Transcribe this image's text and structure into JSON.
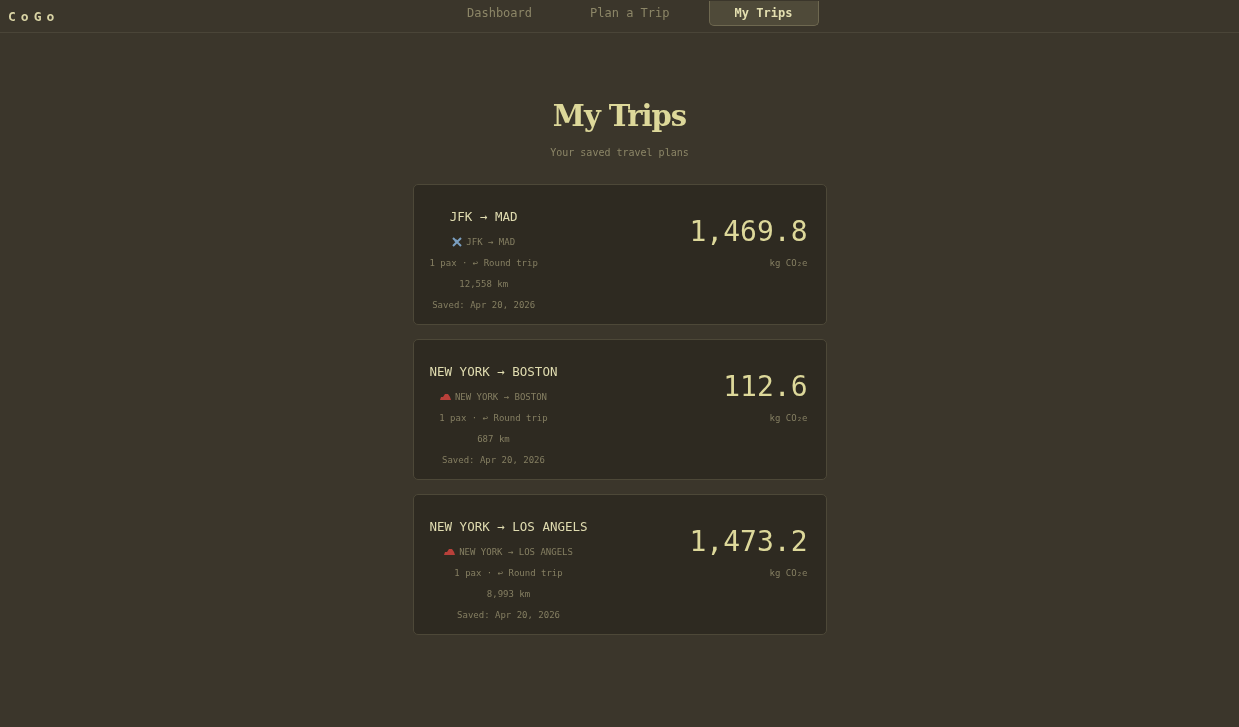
{
  "brand": "CoGo",
  "nav": [
    {
      "label": "Dashboard",
      "selected": false
    },
    {
      "label": "Plan a Trip",
      "selected": false
    },
    {
      "label": "My Trips",
      "selected": true
    }
  ],
  "title": "My Trips",
  "subtitle": "Your saved travel plans",
  "trips": [
    {
      "title": "JFK → MAD",
      "kind": "flight",
      "route": "JFK → MAD",
      "details": "1 pax · ↩ Round trip",
      "distance": "12,558 km",
      "saved": "Saved: Apr 20, 2026",
      "value": "1,469.8",
      "unit": "kg CO₂e"
    },
    {
      "title": "NEW YORK → BOSTON",
      "kind": "car",
      "route": "NEW YORK → BOSTON",
      "details": "1 pax · ↩ Round trip",
      "distance": "687 km",
      "saved": "Saved: Apr 20, 2026",
      "value": "112.6",
      "unit": "kg CO₂e"
    },
    {
      "title": "NEW YORK → LOS ANGELS",
      "kind": "car",
      "route": "NEW YORK → LOS ANGELS",
      "details": "1 pax · ↩ Round trip",
      "distance": "8,993 km",
      "saved": "Saved: Apr 20, 2026",
      "value": "1,473.2",
      "unit": "kg CO₂e"
    }
  ]
}
